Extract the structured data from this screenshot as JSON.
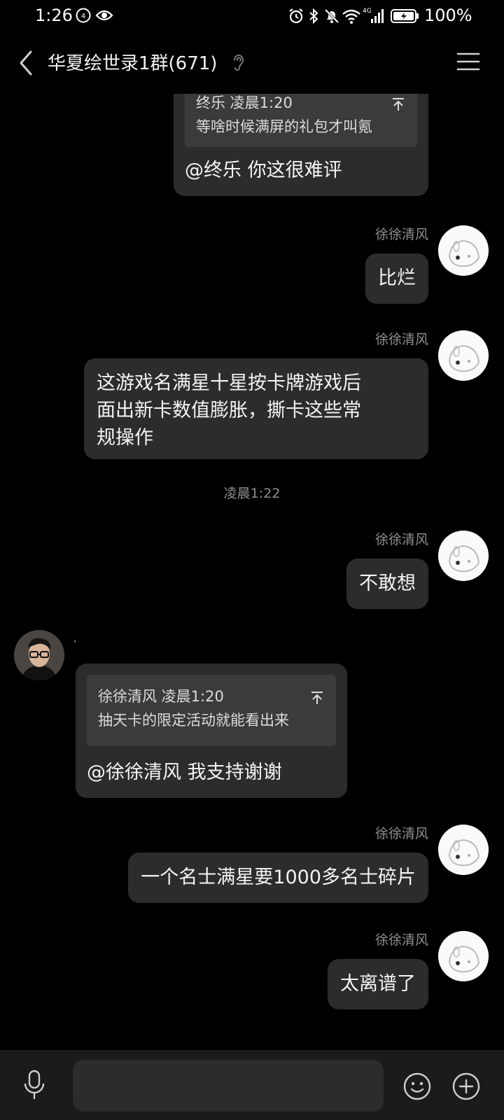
{
  "status_bar": {
    "time": "1:26",
    "battery": "100%",
    "icons": [
      "dnd-badge-icon",
      "eye-icon",
      "alarm-icon",
      "bluetooth-icon",
      "mute-icon",
      "wifi-icon",
      "signal-4g-icon",
      "battery-icon"
    ]
  },
  "header": {
    "title": "华夏绘世录1群(671)",
    "icons": [
      "back-icon",
      "ear-icon",
      "menu-icon"
    ]
  },
  "messages": [
    {
      "type": "outgoing-reply",
      "quote_author": "终乐 凌晨1:20",
      "quote_text": "等啥时候满屏的礼包才叫氪",
      "text": "@终乐 你这很难评"
    },
    {
      "type": "outgoing",
      "sender": "徐徐清风",
      "text": "比烂"
    },
    {
      "type": "outgoing",
      "sender": "徐徐清风",
      "text_lines": [
        "这游戏名满星十星按卡牌游戏后",
        "面出新卡数值膨胀，撕卡这些常",
        "规操作"
      ]
    },
    {
      "type": "timestamp",
      "text": "凌晨1:22"
    },
    {
      "type": "outgoing",
      "sender": "徐徐清风",
      "text": "不敢想"
    },
    {
      "type": "incoming-reply",
      "sender": "·",
      "quote_author": "徐徐清风 凌晨1:20",
      "quote_text": "抽天卡的限定活动就能看出来",
      "text": "@徐徐清风 我支持谢谢"
    },
    {
      "type": "outgoing",
      "sender": "徐徐清风",
      "text": "一个名士满星要1000多名士碎片"
    },
    {
      "type": "outgoing",
      "sender": "徐徐清风",
      "text": "太离谱了"
    }
  ],
  "input_bar": {
    "value": "",
    "icons": [
      "mic-icon",
      "emoji-icon",
      "plus-icon"
    ]
  },
  "colors": {
    "background": "#000000",
    "bubble": "#2c2c2c",
    "quote": "#3b3b3b",
    "secondary_text": "#8f8f8f",
    "input_bar": "#1b1b1b"
  }
}
